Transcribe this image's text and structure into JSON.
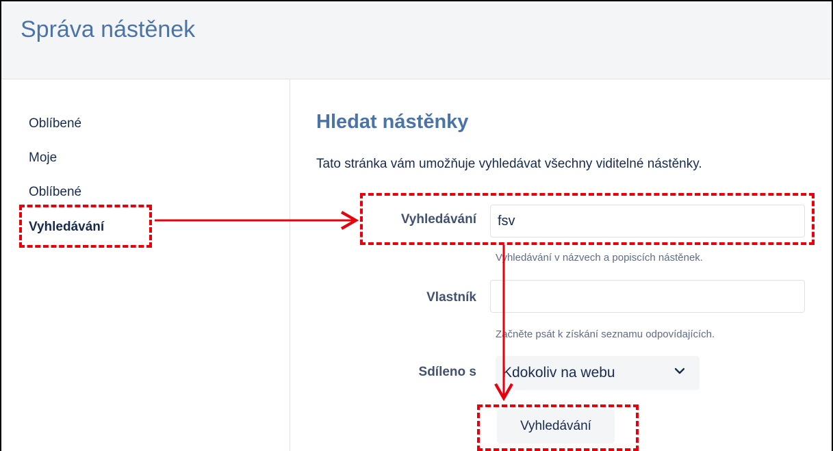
{
  "header": {
    "title": "Správa nástěnek"
  },
  "sidebar": {
    "items": [
      {
        "label": "Oblíbené"
      },
      {
        "label": "Moje"
      },
      {
        "label": "Oblíbené"
      },
      {
        "label": "Vyhledávání"
      }
    ]
  },
  "main": {
    "title": "Hledat nástěnky",
    "description": "Tato stránka vám umožňuje vyhledávat všechny viditelné nástěnky.",
    "form": {
      "search": {
        "label": "Vyhledávání",
        "value": "fsv",
        "hint": "Vyhledávání v názvech a popiscích nástěnek."
      },
      "owner": {
        "label": "Vlastník",
        "value": "",
        "hint": "Začněte psát k získání seznamu odpovídajících."
      },
      "shared": {
        "label": "Sdíleno s",
        "selected": "Kdokoliv na webu"
      },
      "submit_label": "Vyhledávání"
    }
  },
  "colors": {
    "accent": "#4a74a8",
    "annotation": "#e8000b",
    "header_bg": "#f4f5f7"
  },
  "icons": [
    "chevron-down-icon"
  ]
}
